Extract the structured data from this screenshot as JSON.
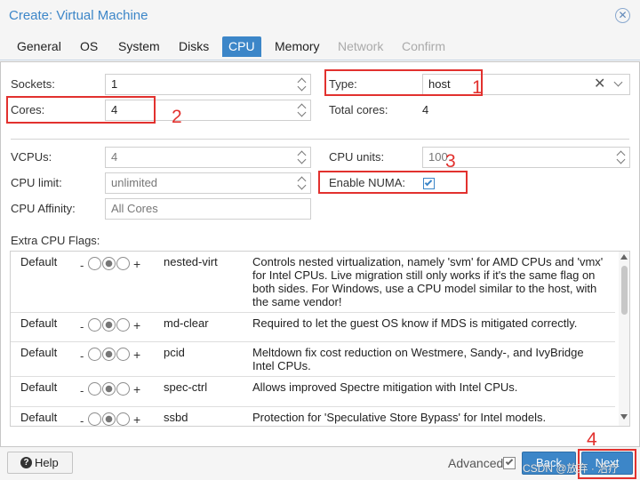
{
  "window": {
    "title": "Create: Virtual Machine"
  },
  "tabs": [
    {
      "label": "General",
      "state": "normal"
    },
    {
      "label": "OS",
      "state": "normal"
    },
    {
      "label": "System",
      "state": "normal"
    },
    {
      "label": "Disks",
      "state": "normal"
    },
    {
      "label": "CPU",
      "state": "active"
    },
    {
      "label": "Memory",
      "state": "normal"
    },
    {
      "label": "Network",
      "state": "disabled"
    },
    {
      "label": "Confirm",
      "state": "disabled"
    }
  ],
  "cpu": {
    "sockets": {
      "label": "Sockets:",
      "value": "1"
    },
    "cores": {
      "label": "Cores:",
      "value": "4"
    },
    "type": {
      "label": "Type:",
      "value": "host"
    },
    "total_cores": {
      "label": "Total cores:",
      "value": "4"
    },
    "vcpus": {
      "label": "VCPUs:",
      "value": "4"
    },
    "cpu_units": {
      "label": "CPU units:",
      "value": "100"
    },
    "cpu_limit": {
      "label": "CPU limit:",
      "value": "unlimited"
    },
    "enable_numa": {
      "label": "Enable NUMA:",
      "checked": true
    },
    "cpu_affinity": {
      "label": "CPU Affinity:",
      "placeholder": "All Cores"
    },
    "extra_flags_label": "Extra CPU Flags:"
  },
  "annotations": [
    "1",
    "2",
    "3",
    "4"
  ],
  "flags": [
    {
      "default": "Default",
      "minus": "-",
      "plus": "+",
      "name": "nested-virt",
      "description": "Controls nested virtualization, namely 'svm' for AMD CPUs and 'vmx' for Intel CPUs. Live migration still only works if it's the same flag on both sides. For Windows, use a CPU model similar to the host, with the same vendor!"
    },
    {
      "default": "Default",
      "minus": "-",
      "plus": "+",
      "name": "md-clear",
      "description": "Required to let the guest OS know if MDS is mitigated correctly."
    },
    {
      "default": "Default",
      "minus": "-",
      "plus": "+",
      "name": "pcid",
      "description": "Meltdown fix cost reduction on Westmere, Sandy-, and IvyBridge Intel CPUs."
    },
    {
      "default": "Default",
      "minus": "-",
      "plus": "+",
      "name": "spec-ctrl",
      "description": "Allows improved Spectre mitigation with Intel CPUs."
    },
    {
      "default": "Default",
      "minus": "-",
      "plus": "+",
      "name": "ssbd",
      "description": "Protection for 'Speculative Store Bypass' for Intel models."
    }
  ],
  "footer": {
    "help_label": "Help",
    "advanced_label": "Advanced",
    "advanced_checked": true,
    "back_label": "Back",
    "next_label": "Next",
    "watermark": "CSDN @放弃 · 治疗"
  },
  "icons": {
    "close": "close-circle-icon",
    "help": "help-circle-icon",
    "clear": "clear-x-icon",
    "dropdown": "chevron-down-icon",
    "spinner": "spinner-arrows-icon"
  },
  "colors": {
    "accent": "#3c86c8",
    "annotation": "#e2312e"
  }
}
